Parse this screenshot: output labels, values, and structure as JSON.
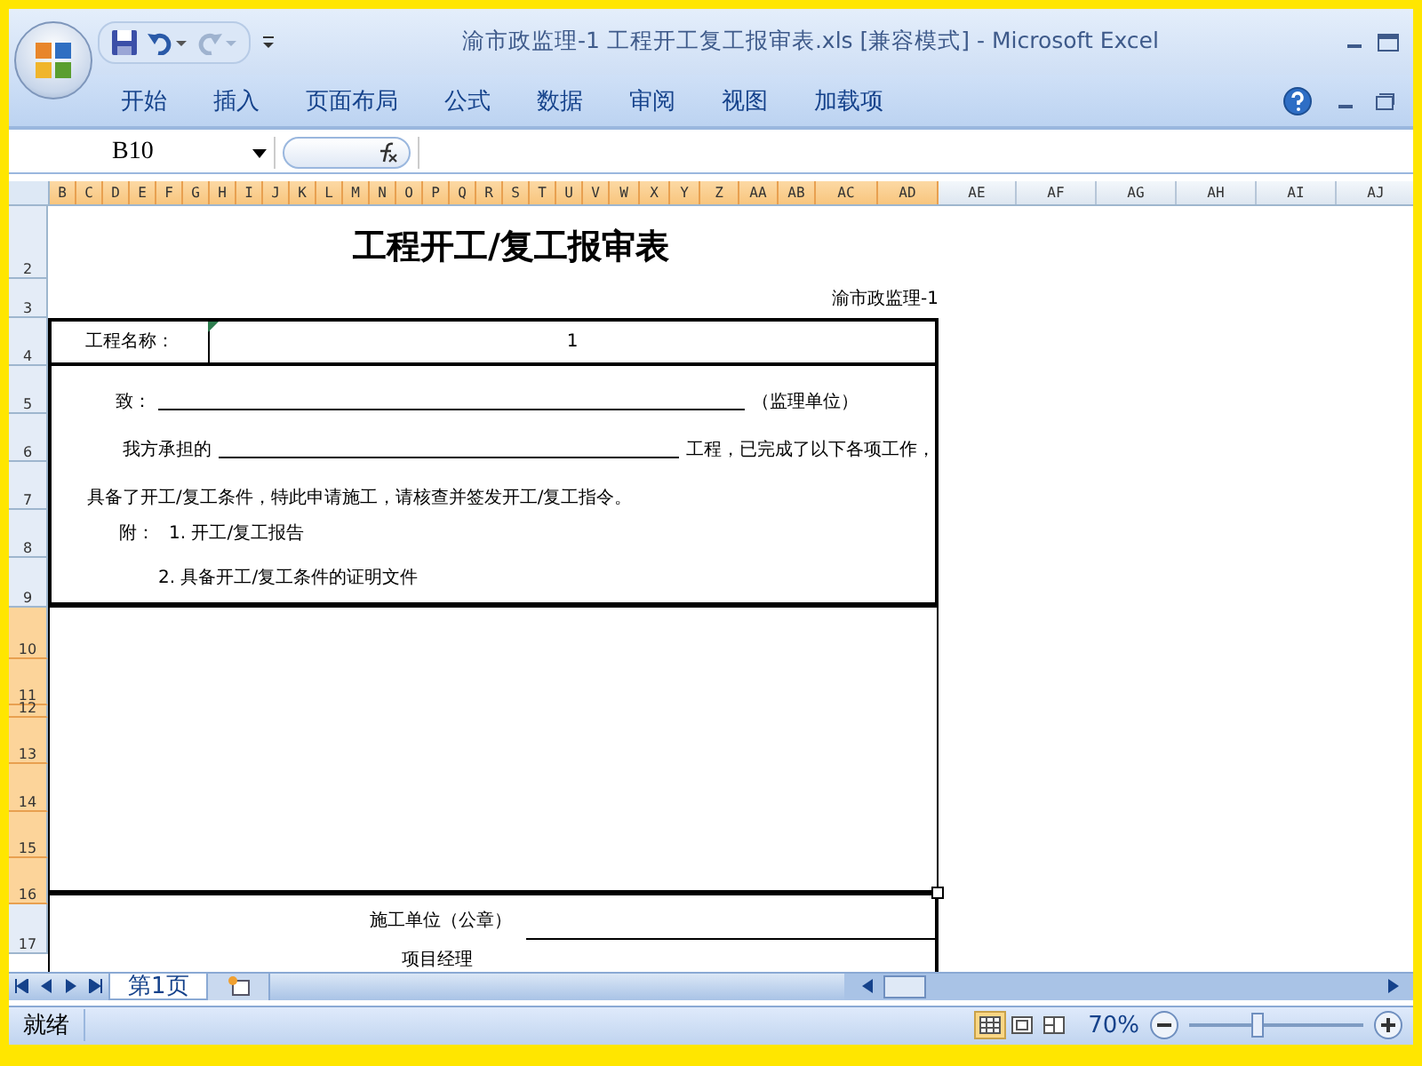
{
  "window": {
    "title": "渝市政监理-1 工程开工复工报审表.xls  [兼容模式] - Microsoft Excel"
  },
  "ribbon_tabs": [
    {
      "label": "开始",
      "selected": false
    },
    {
      "label": "插入",
      "selected": false
    },
    {
      "label": "页面布局",
      "selected": false
    },
    {
      "label": "公式",
      "selected": false
    },
    {
      "label": "数据",
      "selected": false
    },
    {
      "label": "审阅",
      "selected": false
    },
    {
      "label": "视图",
      "selected": false
    },
    {
      "label": "加载项",
      "selected": false
    }
  ],
  "name_box": {
    "value": "B10"
  },
  "columns": [
    {
      "label": "B",
      "selected": true
    },
    {
      "label": "C",
      "selected": true
    },
    {
      "label": "D",
      "selected": true
    },
    {
      "label": "E",
      "selected": true
    },
    {
      "label": "F",
      "selected": true
    },
    {
      "label": "G",
      "selected": true
    },
    {
      "label": "H",
      "selected": true
    },
    {
      "label": "I",
      "selected": true
    },
    {
      "label": "J",
      "selected": true
    },
    {
      "label": "K",
      "selected": true
    },
    {
      "label": "L",
      "selected": true
    },
    {
      "label": "M",
      "selected": true
    },
    {
      "label": "N",
      "selected": true
    },
    {
      "label": "O",
      "selected": true
    },
    {
      "label": "P",
      "selected": true
    },
    {
      "label": "Q",
      "selected": true
    },
    {
      "label": "R",
      "selected": true
    },
    {
      "label": "S",
      "selected": true
    },
    {
      "label": "T",
      "selected": true
    },
    {
      "label": "U",
      "selected": true
    },
    {
      "label": "V",
      "selected": true
    },
    {
      "label": "W",
      "selected": true
    },
    {
      "label": "X",
      "selected": true
    },
    {
      "label": "Y",
      "selected": true
    },
    {
      "label": "Z",
      "selected": true
    },
    {
      "label": "AA",
      "selected": true
    },
    {
      "label": "AB",
      "selected": true
    },
    {
      "label": "AC",
      "selected": true
    },
    {
      "label": "AD",
      "selected": true
    },
    {
      "label": "AE",
      "selected": false
    },
    {
      "label": "AF",
      "selected": false
    },
    {
      "label": "AG",
      "selected": false
    },
    {
      "label": "AH",
      "selected": false
    },
    {
      "label": "AI",
      "selected": false
    },
    {
      "label": "AJ",
      "selected": false
    }
  ],
  "rows": [
    {
      "label": "2",
      "selected": false
    },
    {
      "label": "3",
      "selected": false
    },
    {
      "label": "4",
      "selected": false
    },
    {
      "label": "5",
      "selected": false
    },
    {
      "label": "6",
      "selected": false
    },
    {
      "label": "7",
      "selected": false
    },
    {
      "label": "8",
      "selected": false
    },
    {
      "label": "9",
      "selected": false
    },
    {
      "label": "10",
      "selected": true
    },
    {
      "label": "11",
      "selected": true
    },
    {
      "label": "12",
      "selected": true
    },
    {
      "label": "13",
      "selected": true
    },
    {
      "label": "14",
      "selected": true
    },
    {
      "label": "15",
      "selected": true
    },
    {
      "label": "16",
      "selected": true
    },
    {
      "label": "17",
      "selected": false
    }
  ],
  "sheet": {
    "title": "工程开工/复工报审表",
    "form_code": "渝市政监理-1",
    "project_label": "工程名称：",
    "project_value": "1",
    "to_label": "致：",
    "to_suffix": "（监理单位）",
    "undertake_prefix": "我方承担的",
    "undertake_suffix": "工程，已完成了以下各项工作，",
    "statement": "具备了开工/复工条件，特此申请施工，请核查并签发开工/复工指令。",
    "attachments_label": "附：",
    "attachments": [
      "1.  开工/复工报告",
      "2.  具备开工/复工条件的证明文件"
    ],
    "contractor_label": "施工单位（公章）",
    "manager_label": "项目经理"
  },
  "sheet_tabs": [
    {
      "label": "第1页",
      "selected": true
    }
  ],
  "status_bar": {
    "status": "就绪",
    "views": [
      {
        "kind": "normal",
        "selected": true
      },
      {
        "kind": "layout",
        "selected": false
      },
      {
        "kind": "pagebreak",
        "selected": false
      }
    ],
    "zoom": "70%",
    "zoom_slider": {
      "level": 0.4
    }
  }
}
